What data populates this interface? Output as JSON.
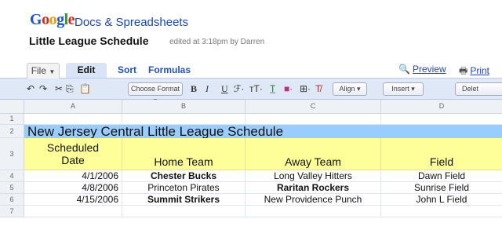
{
  "app": {
    "logo": "Google",
    "product": "Docs & Spreadsheets",
    "doc_title": "Little League Schedule",
    "edited": "edited at 3:18pm by Darren"
  },
  "tabs": {
    "file": "File",
    "edit": "Edit",
    "sort": "Sort",
    "formulas": "Formulas"
  },
  "links": {
    "preview": "Preview",
    "print": "Print"
  },
  "toolbar": {
    "choose_format": "Choose Format",
    "align": "Align",
    "insert": "Insert",
    "delete": "Delet"
  },
  "sheet": {
    "columns": [
      "A",
      "B",
      "C",
      "D"
    ],
    "row_numbers": [
      "1",
      "2",
      "3",
      "4",
      "5",
      "6",
      "7"
    ],
    "title": "New Jersey Central Little League Schedule",
    "headers": {
      "date_line1": "Scheduled",
      "date_line2": "Date",
      "home": "Home Team",
      "away": "Away Team",
      "field": "Field"
    },
    "rows": [
      {
        "date": "4/1/2006",
        "home": "Chester Bucks",
        "home_bold": true,
        "away": "Long Valley Hitters",
        "away_bold": false,
        "field": "Dawn Field"
      },
      {
        "date": "4/8/2006",
        "home": "Princeton Pirates",
        "home_bold": false,
        "away": "Raritan Rockers",
        "away_bold": true,
        "field": "Sunrise Field"
      },
      {
        "date": "4/15/2006",
        "home": "Summit Strikers",
        "home_bold": true,
        "away": "New Providence Punch",
        "away_bold": false,
        "field": "John L Field"
      }
    ]
  },
  "colors": {
    "title_fill": "#99ccff",
    "header_fill": "#ffff99",
    "toolbar_bg": "#dfe8f7",
    "link": "#2045c0"
  }
}
